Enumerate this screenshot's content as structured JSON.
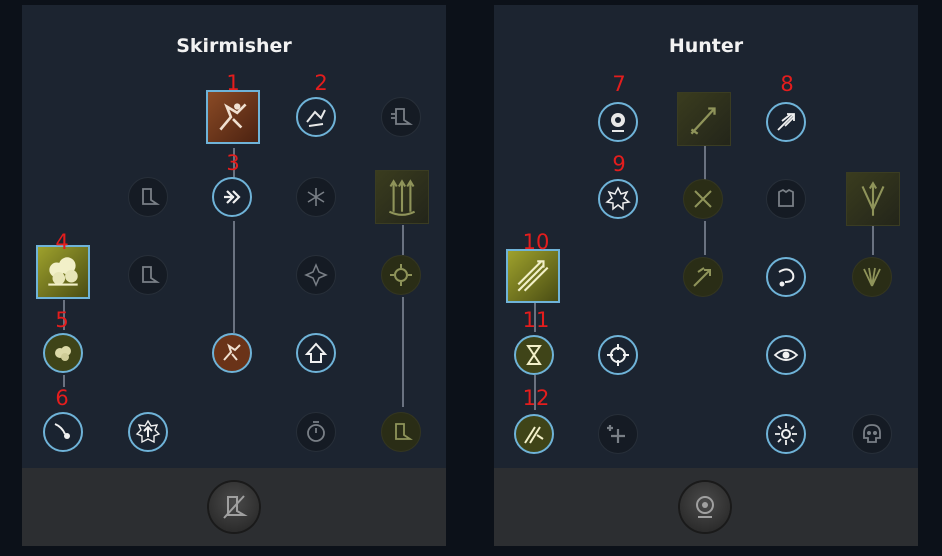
{
  "trees": {
    "left": {
      "title": "Skirmisher"
    },
    "right": {
      "title": "Hunter"
    }
  },
  "markers": [
    "1",
    "2",
    "3",
    "4",
    "5",
    "6",
    "7",
    "8",
    "9",
    "10",
    "11",
    "12"
  ],
  "colors": {
    "marker": "#e41d1d",
    "active_border": "#6fb3d8",
    "panel": "#1c2430",
    "footer": "#2c2e31"
  }
}
